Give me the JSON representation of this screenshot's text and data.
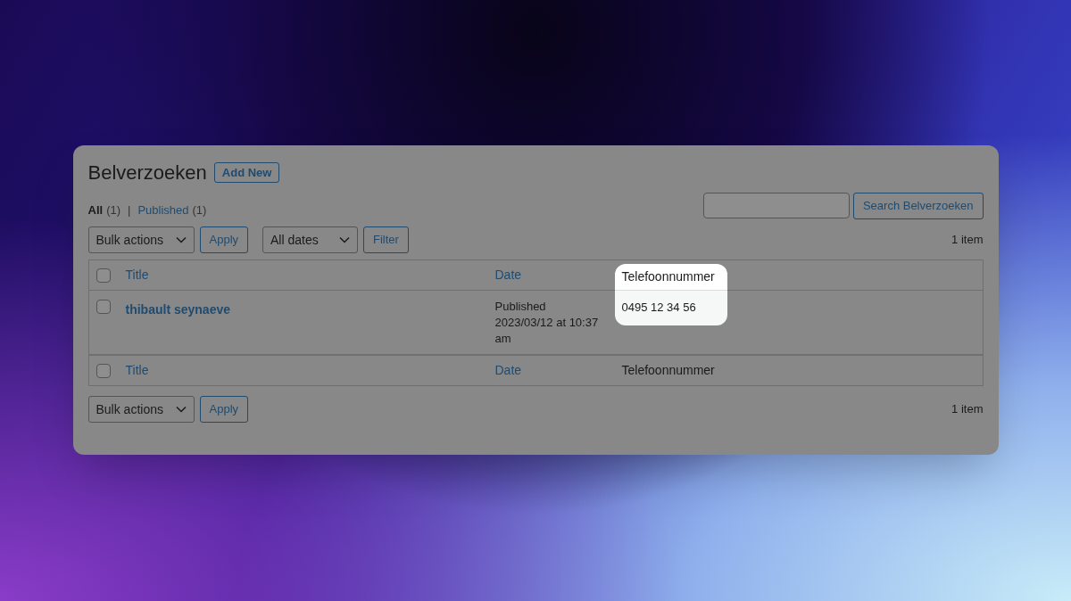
{
  "page": {
    "title": "Belverzoeken",
    "add_new": "Add New"
  },
  "views": [
    {
      "label": "All",
      "count": "(1)",
      "selected": true
    },
    {
      "label": "Published",
      "count": "(1)",
      "selected": false
    }
  ],
  "view_separator": "|",
  "search": {
    "button": "Search Belverzoeken"
  },
  "top_nav": {
    "bulk_actions": "Bulk actions",
    "apply": "Apply",
    "dates": "All dates",
    "filter": "Filter",
    "count": "1 item"
  },
  "table_header": {
    "checked": false,
    "columns": [
      {
        "kind": "title",
        "label": "Title",
        "sortable": true,
        "highlighted": false
      },
      {
        "kind": "date",
        "label": "Date",
        "sortable": true,
        "highlighted": false
      },
      {
        "kind": "phone",
        "label": "Telefoonnummer",
        "sortable": false,
        "highlighted": true
      }
    ]
  },
  "rows": [
    {
      "checked": false,
      "title": "thibault seynaeve",
      "status": "Published",
      "date": "2023/03/12 at 10:37 am",
      "phone": "0495 12 34 56"
    }
  ],
  "table_footer": {
    "checked": false,
    "columns": [
      {
        "kind": "title",
        "label": "Title",
        "sortable": true
      },
      {
        "kind": "date",
        "label": "Date",
        "sortable": true
      },
      {
        "kind": "phone",
        "label": "Telefoonnummer",
        "sortable": false
      }
    ]
  },
  "bottom_nav": {
    "bulk_actions": "Bulk actions",
    "apply": "Apply",
    "count": "1 item"
  }
}
